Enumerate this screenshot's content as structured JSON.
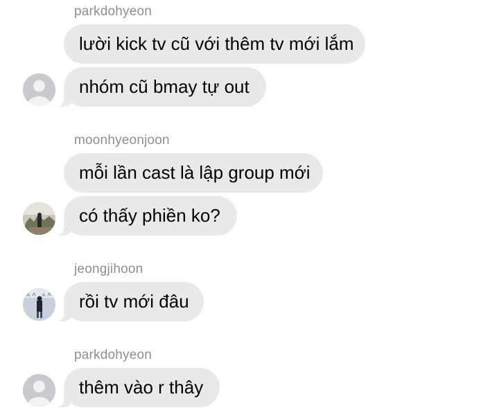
{
  "groups": [
    {
      "sender": "parkdohyeon",
      "avatar_icon": "default-person-avatar-icon",
      "messages": [
        "lười kick tv cũ với thêm tv mới lắm",
        "nhóm cũ bmay tự out"
      ]
    },
    {
      "sender": "moonhyeonjoon",
      "avatar_icon": "photo-avatar-icon",
      "messages": [
        "mỗi lần cast là lập group mới",
        "có thấy phiền ko?"
      ]
    },
    {
      "sender": "jeongjihoon",
      "avatar_icon": "photo-avatar-icon",
      "messages": [
        "rồi tv mới đâu"
      ]
    },
    {
      "sender": "parkdohyeon",
      "avatar_icon": "default-person-avatar-icon",
      "messages": [
        "thêm vào r thây"
      ]
    }
  ],
  "colors": {
    "bubble": "#e9e9eb",
    "sender_text": "#8e8e93",
    "message_text": "#000000",
    "background": "#ffffff"
  }
}
